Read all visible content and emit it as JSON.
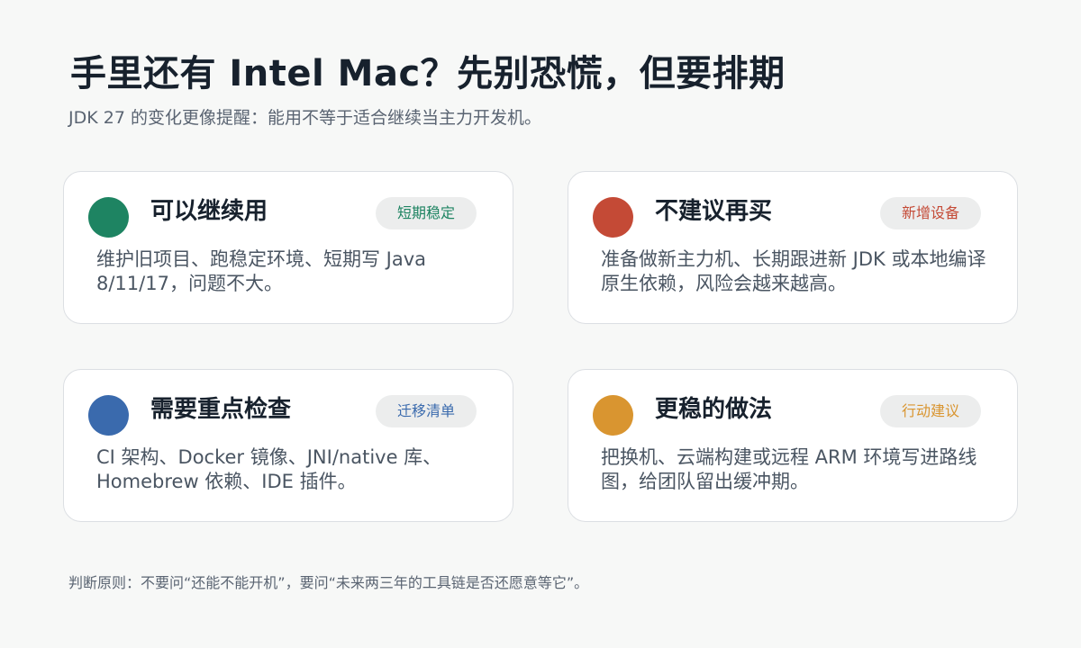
{
  "header": {
    "title": "手里还有 Intel Mac？先别恐慌，但要排期",
    "subtitle": "JDK 27 的变化更像提醒：能用不等于适合继续当主力开发机。"
  },
  "cards": [
    {
      "title": "可以继续用",
      "badge": "短期稳定",
      "body": "维护旧项目、跑稳定环境、短期写 Java 8/11/17，问题不大。",
      "dot_color": "#1e8462",
      "badge_color": "#1e8462",
      "dot_icon": "green-circle"
    },
    {
      "title": "不建议再买",
      "badge": "新增设备",
      "body": "准备做新主力机、长期跟进新 JDK 或本地编译原生依赖，风险会越来越高。",
      "dot_color": "#c44a36",
      "badge_color": "#c44a36",
      "dot_icon": "red-circle"
    },
    {
      "title": "需要重点检查",
      "badge": "迁移清单",
      "body": "CI 架构、Docker 镜像、JNI/native 库、Homebrew 依赖、IDE 插件。",
      "dot_color": "#3a6aad",
      "badge_color": "#3a6aad",
      "dot_icon": "blue-circle"
    },
    {
      "title": "更稳的做法",
      "badge": "行动建议",
      "body": "把换机、云端构建或远程 ARM 环境写进路线图，给团队留出缓冲期。",
      "dot_color": "#d99530",
      "badge_color": "#d99530",
      "dot_icon": "orange-circle"
    }
  ],
  "footer": {
    "note": "判断原则：不要问“还能不能开机”，要问“未来两三年的工具链是否还愿意等它”。"
  }
}
